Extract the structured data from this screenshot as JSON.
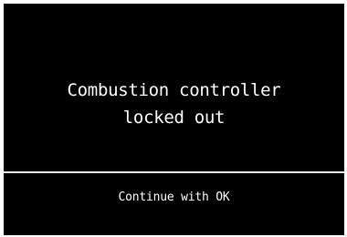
{
  "display": {
    "message_line1": "Combustion controller",
    "message_line2": "locked out",
    "action_hint": "Continue with OK"
  },
  "colors": {
    "background": "#000000",
    "text": "#ffffff",
    "divider": "#e8e8e8"
  }
}
